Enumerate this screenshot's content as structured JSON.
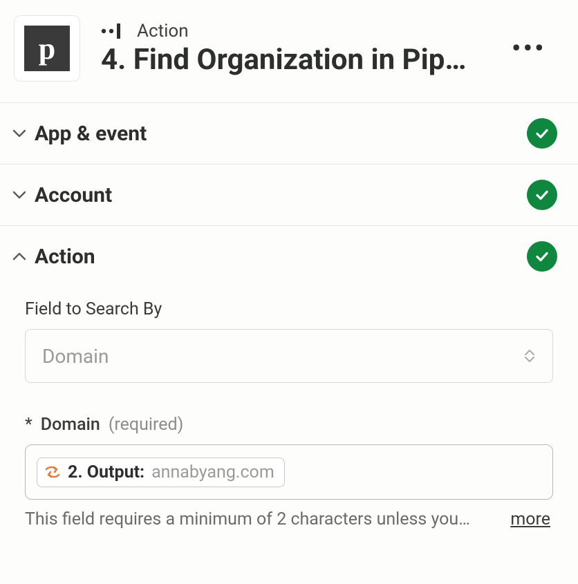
{
  "header": {
    "app_letter": "p",
    "kicker": "Action",
    "title": "4. Find Organization in Pip…"
  },
  "sections": {
    "app_event": {
      "label": "App & event"
    },
    "account": {
      "label": "Account"
    },
    "action": {
      "label": "Action"
    }
  },
  "form": {
    "search_by": {
      "label": "Field to Search By",
      "value": "Domain"
    },
    "domain": {
      "required_mark": "*",
      "name": "Domain",
      "required_text": "(required)",
      "pill_label": "2. Output:",
      "pill_value": "annabyang.com",
      "help": "This field requires a minimum of 2 characters unless you…",
      "more": "more"
    }
  }
}
